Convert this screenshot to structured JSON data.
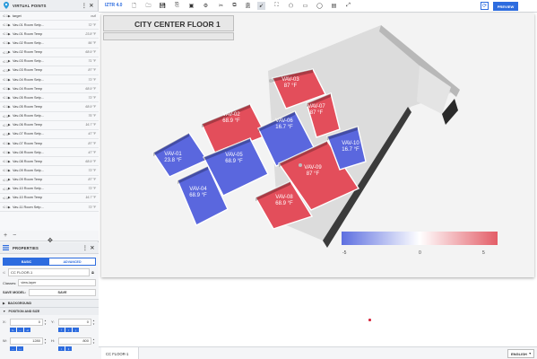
{
  "sidebar": {
    "virtual_points": {
      "title": "VIRTUAL POINTS",
      "items": [
        {
          "label": "target",
          "value": "null"
        },
        {
          "label": "Vav-01 Room Setp...",
          "value": "72 °F"
        },
        {
          "label": "Vav-01 Room Temp",
          "value": "23.8 °F"
        },
        {
          "label": "Vav-02 Room Setp...",
          "value": "56 °F"
        },
        {
          "label": "Vav-02 Room Temp",
          "value": "68.9 °F"
        },
        {
          "label": "Vav-03 Room Setp...",
          "value": "71 °F"
        },
        {
          "label": "Vav-03 Room Temp",
          "value": "87 °F"
        },
        {
          "label": "Vav-04 Room Setp...",
          "value": "73 °F"
        },
        {
          "label": "Vav-04 Room Temp",
          "value": "68.9 °F"
        },
        {
          "label": "Vav-05 Room Setp...",
          "value": "73 °F"
        },
        {
          "label": "Vav-05 Room Temp",
          "value": "68.9 °F"
        },
        {
          "label": "Vav-06 Room Setp...",
          "value": "75 °F"
        },
        {
          "label": "Vav-06 Room Temp",
          "value": "16.7 °F"
        },
        {
          "label": "Vav-07 Room Setp...",
          "value": "47 °F"
        },
        {
          "label": "Vav-07 Room Temp",
          "value": "87 °F"
        },
        {
          "label": "Vav-08 Room Setp...",
          "value": "47 °F"
        },
        {
          "label": "Vav-08 Room Temp",
          "value": "68.9 °F"
        },
        {
          "label": "Vav-09 Room Setp...",
          "value": "73 °F"
        },
        {
          "label": "Vav-09 Room Temp",
          "value": "87 °F"
        },
        {
          "label": "Vav-10 Room Setp...",
          "value": "73 °F"
        },
        {
          "label": "Vav-10 Room Temp",
          "value": "16.7 °F"
        },
        {
          "label": "Vav-11 Room Setp...",
          "value": "73 °F"
        }
      ],
      "footer_add": "+",
      "footer_remove": "−"
    },
    "properties": {
      "title": "PROPERTIES",
      "tab_basic": "BASIC",
      "tab_advanced": "ADVANCED",
      "name_value": "CC FLOOR-1",
      "classes_label": "Classes:",
      "classes_value": "view-layer",
      "save_model_label": "SAVE MODEL:",
      "save_button": "SAVE",
      "section_background": "BACKGROUND",
      "section_position": "POSITION AND SIZE",
      "x_label": "X:",
      "x_value": "0",
      "y_label": "Y:",
      "y_value": "0",
      "w_label": "W:",
      "w_value": "1280",
      "h_label": "H:",
      "h_value": "800"
    }
  },
  "toolbar": {
    "logo": "IZTR 4.0",
    "preview": "PREVIEW"
  },
  "canvas": {
    "title": "CITY CENTER FLOOR 1",
    "rooms": [
      {
        "name": "VAV-01",
        "temp": "23.8 °F",
        "color": "#5a67de"
      },
      {
        "name": "VAV-02",
        "temp": "68.9 °F",
        "color": "#e34e5b"
      },
      {
        "name": "VAV-03",
        "temp": "87 °F",
        "color": "#e34e5b"
      },
      {
        "name": "VAV-04",
        "temp": "68.9 °F",
        "color": "#5a67de"
      },
      {
        "name": "VAV-05",
        "temp": "68.9 °F",
        "color": "#5a67de"
      },
      {
        "name": "VAV-06",
        "temp": "16.7 °F",
        "color": "#5a67de"
      },
      {
        "name": "VAV-07",
        "temp": "87 °F",
        "color": "#e34e5b"
      },
      {
        "name": "VAV-08",
        "temp": "68.9 °F",
        "color": "#e34e5b"
      },
      {
        "name": "VAV-09",
        "temp": "87 °F",
        "color": "#e34e5b"
      },
      {
        "name": "VAV-10",
        "temp": "16.7 °F",
        "color": "#5a67de"
      }
    ],
    "legend": {
      "min": "-5",
      "mid": "0",
      "max": "5",
      "low_color": "#5d6fe0",
      "high_color": "#e35d67"
    }
  },
  "bottom": {
    "page_tab": "CC FLOOR-1",
    "language": "ENGLISH"
  },
  "colors": {
    "accent": "#2d6cdf"
  }
}
